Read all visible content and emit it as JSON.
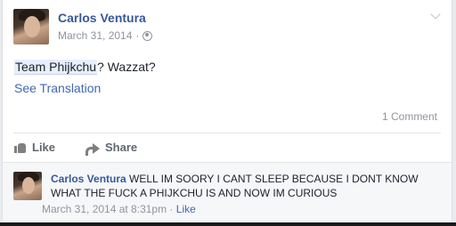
{
  "post": {
    "author": "Carlos Ventura",
    "date": "March 31, 2014",
    "dot": "·",
    "privacy_icon": "globe-icon",
    "text_highlight": "Team Phijkchu",
    "text_rest": "? Wazzat?",
    "see_translation": "See Translation",
    "comment_count": "1 Comment"
  },
  "actions": {
    "like": "Like",
    "share": "Share"
  },
  "comment": {
    "author": "Carlos Ventura",
    "text": "WELL IM SOORY I CANT SLEEP BECAUSE I DONT KNOW WHAT THE FUCK A PHIJKCHU IS AND NOW IM CURIOUS",
    "timestamp": "March 31, 2014 at 8:31pm",
    "dot": " · ",
    "like": "Like"
  },
  "colors": {
    "link": "#365899",
    "muted": "#90949c",
    "background": "#e9ebee"
  }
}
